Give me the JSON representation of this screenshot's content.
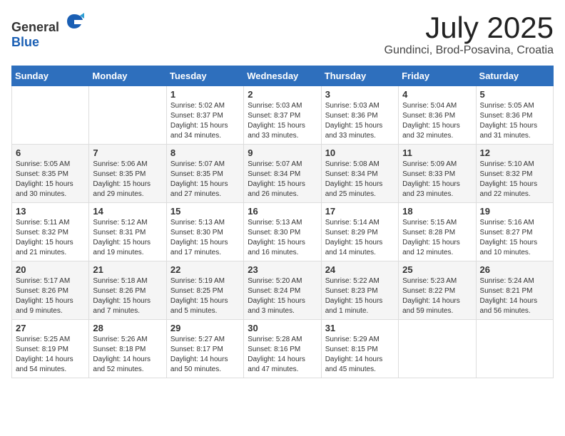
{
  "header": {
    "logo_general": "General",
    "logo_blue": "Blue",
    "month": "July 2025",
    "location": "Gundinci, Brod-Posavina, Croatia"
  },
  "days_of_week": [
    "Sunday",
    "Monday",
    "Tuesday",
    "Wednesday",
    "Thursday",
    "Friday",
    "Saturday"
  ],
  "weeks": [
    [
      {
        "day": "",
        "sunrise": "",
        "sunset": "",
        "daylight": ""
      },
      {
        "day": "",
        "sunrise": "",
        "sunset": "",
        "daylight": ""
      },
      {
        "day": "1",
        "sunrise": "Sunrise: 5:02 AM",
        "sunset": "Sunset: 8:37 PM",
        "daylight": "Daylight: 15 hours and 34 minutes."
      },
      {
        "day": "2",
        "sunrise": "Sunrise: 5:03 AM",
        "sunset": "Sunset: 8:37 PM",
        "daylight": "Daylight: 15 hours and 33 minutes."
      },
      {
        "day": "3",
        "sunrise": "Sunrise: 5:03 AM",
        "sunset": "Sunset: 8:36 PM",
        "daylight": "Daylight: 15 hours and 33 minutes."
      },
      {
        "day": "4",
        "sunrise": "Sunrise: 5:04 AM",
        "sunset": "Sunset: 8:36 PM",
        "daylight": "Daylight: 15 hours and 32 minutes."
      },
      {
        "day": "5",
        "sunrise": "Sunrise: 5:05 AM",
        "sunset": "Sunset: 8:36 PM",
        "daylight": "Daylight: 15 hours and 31 minutes."
      }
    ],
    [
      {
        "day": "6",
        "sunrise": "Sunrise: 5:05 AM",
        "sunset": "Sunset: 8:35 PM",
        "daylight": "Daylight: 15 hours and 30 minutes."
      },
      {
        "day": "7",
        "sunrise": "Sunrise: 5:06 AM",
        "sunset": "Sunset: 8:35 PM",
        "daylight": "Daylight: 15 hours and 29 minutes."
      },
      {
        "day": "8",
        "sunrise": "Sunrise: 5:07 AM",
        "sunset": "Sunset: 8:35 PM",
        "daylight": "Daylight: 15 hours and 27 minutes."
      },
      {
        "day": "9",
        "sunrise": "Sunrise: 5:07 AM",
        "sunset": "Sunset: 8:34 PM",
        "daylight": "Daylight: 15 hours and 26 minutes."
      },
      {
        "day": "10",
        "sunrise": "Sunrise: 5:08 AM",
        "sunset": "Sunset: 8:34 PM",
        "daylight": "Daylight: 15 hours and 25 minutes."
      },
      {
        "day": "11",
        "sunrise": "Sunrise: 5:09 AM",
        "sunset": "Sunset: 8:33 PM",
        "daylight": "Daylight: 15 hours and 23 minutes."
      },
      {
        "day": "12",
        "sunrise": "Sunrise: 5:10 AM",
        "sunset": "Sunset: 8:32 PM",
        "daylight": "Daylight: 15 hours and 22 minutes."
      }
    ],
    [
      {
        "day": "13",
        "sunrise": "Sunrise: 5:11 AM",
        "sunset": "Sunset: 8:32 PM",
        "daylight": "Daylight: 15 hours and 21 minutes."
      },
      {
        "day": "14",
        "sunrise": "Sunrise: 5:12 AM",
        "sunset": "Sunset: 8:31 PM",
        "daylight": "Daylight: 15 hours and 19 minutes."
      },
      {
        "day": "15",
        "sunrise": "Sunrise: 5:13 AM",
        "sunset": "Sunset: 8:30 PM",
        "daylight": "Daylight: 15 hours and 17 minutes."
      },
      {
        "day": "16",
        "sunrise": "Sunrise: 5:13 AM",
        "sunset": "Sunset: 8:30 PM",
        "daylight": "Daylight: 15 hours and 16 minutes."
      },
      {
        "day": "17",
        "sunrise": "Sunrise: 5:14 AM",
        "sunset": "Sunset: 8:29 PM",
        "daylight": "Daylight: 15 hours and 14 minutes."
      },
      {
        "day": "18",
        "sunrise": "Sunrise: 5:15 AM",
        "sunset": "Sunset: 8:28 PM",
        "daylight": "Daylight: 15 hours and 12 minutes."
      },
      {
        "day": "19",
        "sunrise": "Sunrise: 5:16 AM",
        "sunset": "Sunset: 8:27 PM",
        "daylight": "Daylight: 15 hours and 10 minutes."
      }
    ],
    [
      {
        "day": "20",
        "sunrise": "Sunrise: 5:17 AM",
        "sunset": "Sunset: 8:26 PM",
        "daylight": "Daylight: 15 hours and 9 minutes."
      },
      {
        "day": "21",
        "sunrise": "Sunrise: 5:18 AM",
        "sunset": "Sunset: 8:26 PM",
        "daylight": "Daylight: 15 hours and 7 minutes."
      },
      {
        "day": "22",
        "sunrise": "Sunrise: 5:19 AM",
        "sunset": "Sunset: 8:25 PM",
        "daylight": "Daylight: 15 hours and 5 minutes."
      },
      {
        "day": "23",
        "sunrise": "Sunrise: 5:20 AM",
        "sunset": "Sunset: 8:24 PM",
        "daylight": "Daylight: 15 hours and 3 minutes."
      },
      {
        "day": "24",
        "sunrise": "Sunrise: 5:22 AM",
        "sunset": "Sunset: 8:23 PM",
        "daylight": "Daylight: 15 hours and 1 minute."
      },
      {
        "day": "25",
        "sunrise": "Sunrise: 5:23 AM",
        "sunset": "Sunset: 8:22 PM",
        "daylight": "Daylight: 14 hours and 59 minutes."
      },
      {
        "day": "26",
        "sunrise": "Sunrise: 5:24 AM",
        "sunset": "Sunset: 8:21 PM",
        "daylight": "Daylight: 14 hours and 56 minutes."
      }
    ],
    [
      {
        "day": "27",
        "sunrise": "Sunrise: 5:25 AM",
        "sunset": "Sunset: 8:19 PM",
        "daylight": "Daylight: 14 hours and 54 minutes."
      },
      {
        "day": "28",
        "sunrise": "Sunrise: 5:26 AM",
        "sunset": "Sunset: 8:18 PM",
        "daylight": "Daylight: 14 hours and 52 minutes."
      },
      {
        "day": "29",
        "sunrise": "Sunrise: 5:27 AM",
        "sunset": "Sunset: 8:17 PM",
        "daylight": "Daylight: 14 hours and 50 minutes."
      },
      {
        "day": "30",
        "sunrise": "Sunrise: 5:28 AM",
        "sunset": "Sunset: 8:16 PM",
        "daylight": "Daylight: 14 hours and 47 minutes."
      },
      {
        "day": "31",
        "sunrise": "Sunrise: 5:29 AM",
        "sunset": "Sunset: 8:15 PM",
        "daylight": "Daylight: 14 hours and 45 minutes."
      },
      {
        "day": "",
        "sunrise": "",
        "sunset": "",
        "daylight": ""
      },
      {
        "day": "",
        "sunrise": "",
        "sunset": "",
        "daylight": ""
      }
    ]
  ]
}
